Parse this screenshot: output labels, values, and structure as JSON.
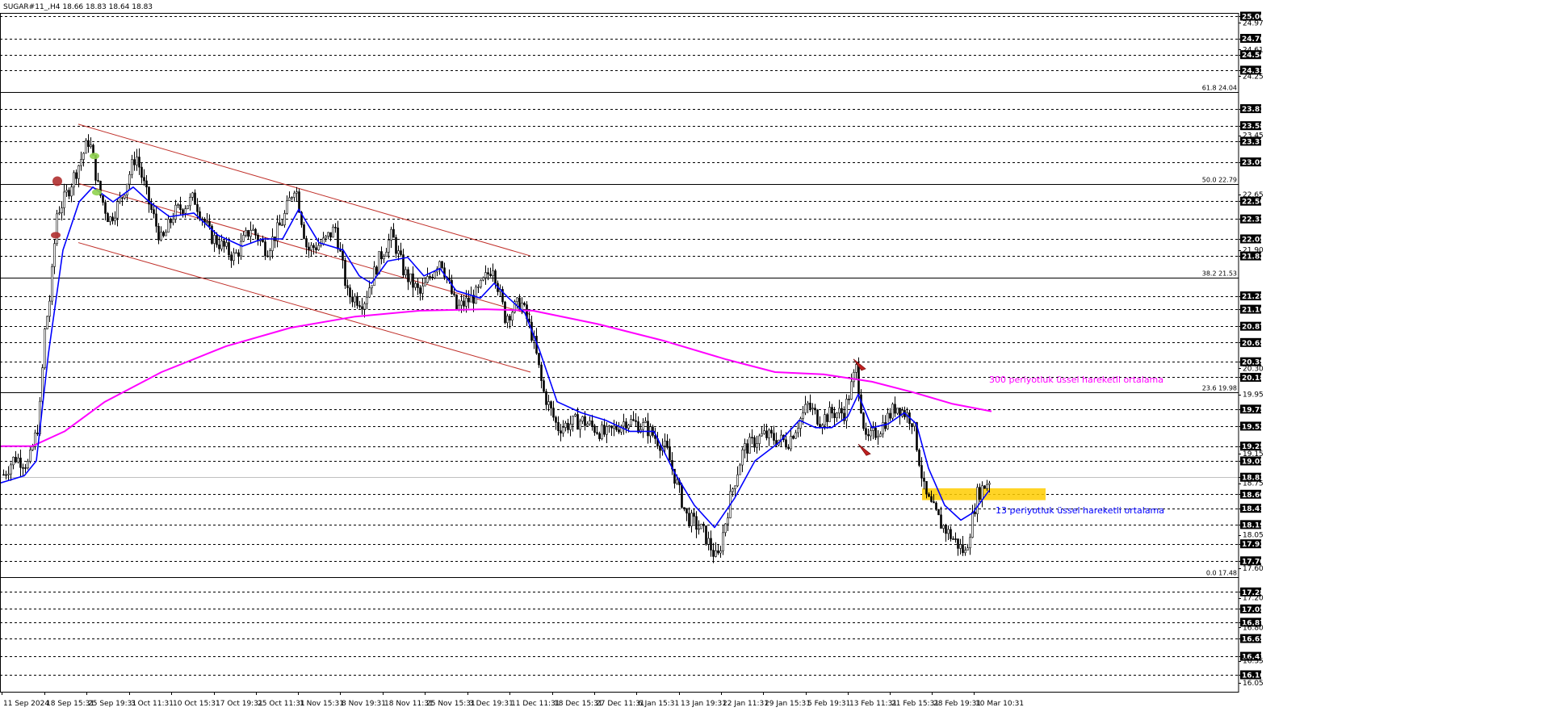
{
  "symbol_info": "SUGAR#11_,H4  18.66 18.83 18.64 18.83",
  "chart_data": {
    "type": "candlestick",
    "title": "",
    "ylim": [
      16.05,
      25.12
    ],
    "price_labels": [
      {
        "text": "25.06",
        "v": 25.06,
        "hl": true
      },
      {
        "text": "24.97",
        "v": 24.97,
        "hl": false
      },
      {
        "text": "24.76",
        "v": 24.76,
        "hl": true
      },
      {
        "text": "24.61",
        "v": 24.61,
        "hl": false
      },
      {
        "text": "24.54",
        "v": 24.54,
        "hl": true
      },
      {
        "text": "24.33",
        "v": 24.33,
        "hl": true
      },
      {
        "text": "24.25",
        "v": 24.25,
        "hl": false
      },
      {
        "text": "23.81",
        "v": 23.81,
        "hl": true
      },
      {
        "text": "23.58",
        "v": 23.58,
        "hl": true
      },
      {
        "text": "23.45",
        "v": 23.45,
        "hl": false
      },
      {
        "text": "23.37",
        "v": 23.37,
        "hl": true
      },
      {
        "text": "23.09",
        "v": 23.09,
        "hl": true
      },
      {
        "text": "22.65",
        "v": 22.65,
        "hl": false
      },
      {
        "text": "22.56",
        "v": 22.56,
        "hl": true
      },
      {
        "text": "22.32",
        "v": 22.32,
        "hl": true
      },
      {
        "text": "22.05",
        "v": 22.05,
        "hl": true
      },
      {
        "text": "21.90",
        "v": 21.9,
        "hl": false
      },
      {
        "text": "21.82",
        "v": 21.82,
        "hl": true
      },
      {
        "text": "21.28",
        "v": 21.28,
        "hl": true
      },
      {
        "text": "21.10",
        "v": 21.1,
        "hl": true
      },
      {
        "text": "20.87",
        "v": 20.87,
        "hl": true
      },
      {
        "text": "20.65",
        "v": 20.65,
        "hl": true
      },
      {
        "text": "20.39",
        "v": 20.39,
        "hl": true
      },
      {
        "text": "20.30",
        "v": 20.3,
        "hl": false
      },
      {
        "text": "20.18",
        "v": 20.18,
        "hl": true
      },
      {
        "text": "19.95",
        "v": 19.95,
        "hl": false
      },
      {
        "text": "19.75",
        "v": 19.75,
        "hl": true
      },
      {
        "text": "19.52",
        "v": 19.52,
        "hl": true
      },
      {
        "text": "19.25",
        "v": 19.25,
        "hl": true
      },
      {
        "text": "19.15",
        "v": 19.15,
        "hl": false
      },
      {
        "text": "19.05",
        "v": 19.05,
        "hl": true
      },
      {
        "text": "18.83",
        "v": 18.83,
        "hl": true
      },
      {
        "text": "18.75",
        "v": 18.75,
        "hl": false
      },
      {
        "text": "18.60",
        "v": 18.6,
        "hl": true
      },
      {
        "text": "18.41",
        "v": 18.41,
        "hl": true
      },
      {
        "text": "18.19",
        "v": 18.19,
        "hl": true
      },
      {
        "text": "18.05",
        "v": 18.05,
        "hl": false
      },
      {
        "text": "17.93",
        "v": 17.93,
        "hl": true
      },
      {
        "text": "17.70",
        "v": 17.7,
        "hl": true
      },
      {
        "text": "17.60",
        "v": 17.6,
        "hl": false
      },
      {
        "text": "17.28",
        "v": 17.28,
        "hl": true
      },
      {
        "text": "17.20",
        "v": 17.2,
        "hl": false
      },
      {
        "text": "17.05",
        "v": 17.05,
        "hl": true
      },
      {
        "text": "16.87",
        "v": 16.87,
        "hl": true
      },
      {
        "text": "16.80",
        "v": 16.8,
        "hl": false
      },
      {
        "text": "16.65",
        "v": 16.65,
        "hl": true
      },
      {
        "text": "16.41",
        "v": 16.41,
        "hl": true
      },
      {
        "text": "16.35",
        "v": 16.35,
        "hl": false
      },
      {
        "text": "16.16",
        "v": 16.16,
        "hl": true
      },
      {
        "text": "16.05",
        "v": 16.05,
        "hl": false
      }
    ],
    "dashed_levels": [
      25.06,
      24.76,
      24.54,
      24.33,
      23.81,
      23.58,
      23.37,
      23.09,
      22.56,
      22.32,
      22.05,
      21.82,
      21.28,
      21.1,
      20.87,
      20.65,
      20.39,
      20.18,
      19.75,
      19.52,
      19.25,
      19.05,
      18.6,
      18.41,
      18.19,
      17.93,
      17.7,
      17.28,
      17.05,
      16.87,
      16.65,
      16.41,
      16.16
    ],
    "fib_levels": [
      {
        "label": "61.8 24.04",
        "v": 24.04
      },
      {
        "label": "50.0 22.79",
        "v": 22.79
      },
      {
        "label": "38.2 21.53",
        "v": 21.53
      },
      {
        "label": "23.6 19.98",
        "v": 19.98
      },
      {
        "label": "0.0 17.48",
        "v": 17.48
      }
    ],
    "current_price": 18.83,
    "time_labels": [
      "11 Sep 2024",
      "18 Sep 15:31",
      "25 Sep 19:31",
      "3 Oct 11:31",
      "10 Oct 15:31",
      "17 Oct 19:31",
      "25 Oct 11:31",
      "1 Nov 15:31",
      "8 Nov 19:31",
      "18 Nov 11:31",
      "25 Nov 15:31",
      "3 Dec 19:31",
      "11 Dec 11:31",
      "18 Dec 15:31",
      "27 Dec 11:31",
      "6 Jan 15:31",
      "13 Jan 19:31",
      "22 Jan 11:31",
      "29 Jan 15:31",
      "5 Feb 19:31",
      "13 Feb 11:31",
      "21 Feb 15:31",
      "28 Feb 19:31",
      "10 Mar 10:31"
    ],
    "price_path": [
      [
        0,
        18.8
      ],
      [
        18,
        19.1
      ],
      [
        35,
        19.0
      ],
      [
        48,
        19.6
      ],
      [
        55,
        20.8
      ],
      [
        62,
        21.3
      ],
      [
        70,
        22.4
      ],
      [
        80,
        22.6
      ],
      [
        95,
        23.0
      ],
      [
        110,
        23.4
      ],
      [
        122,
        22.7
      ],
      [
        135,
        22.3
      ],
      [
        150,
        22.6
      ],
      [
        168,
        23.2
      ],
      [
        182,
        22.6
      ],
      [
        200,
        22.0
      ],
      [
        215,
        22.4
      ],
      [
        240,
        22.6
      ],
      [
        260,
        22.1
      ],
      [
        290,
        21.8
      ],
      [
        310,
        22.2
      ],
      [
        330,
        21.9
      ],
      [
        350,
        22.3
      ],
      [
        365,
        22.8
      ],
      [
        380,
        21.9
      ],
      [
        400,
        22.0
      ],
      [
        415,
        22.2
      ],
      [
        430,
        21.3
      ],
      [
        450,
        21.2
      ],
      [
        470,
        21.8
      ],
      [
        485,
        22.1
      ],
      [
        500,
        21.6
      ],
      [
        520,
        21.3
      ],
      [
        545,
        21.8
      ],
      [
        565,
        21.1
      ],
      [
        590,
        21.3
      ],
      [
        610,
        21.7
      ],
      [
        625,
        21.0
      ],
      [
        645,
        21.2
      ],
      [
        660,
        20.7
      ],
      [
        672,
        20.0
      ],
      [
        690,
        19.5
      ],
      [
        720,
        19.6
      ],
      [
        750,
        19.4
      ],
      [
        775,
        19.6
      ],
      [
        800,
        19.5
      ],
      [
        825,
        19.2
      ],
      [
        850,
        18.3
      ],
      [
        870,
        18.1
      ],
      [
        888,
        17.7
      ],
      [
        905,
        18.6
      ],
      [
        920,
        19.2
      ],
      [
        945,
        19.4
      ],
      [
        975,
        19.3
      ],
      [
        1000,
        19.8
      ],
      [
        1015,
        19.6
      ],
      [
        1030,
        19.7
      ],
      [
        1045,
        19.7
      ],
      [
        1060,
        20.3
      ],
      [
        1072,
        19.3
      ],
      [
        1090,
        19.5
      ],
      [
        1110,
        19.8
      ],
      [
        1130,
        19.6
      ],
      [
        1145,
        18.6
      ],
      [
        1165,
        18.2
      ],
      [
        1180,
        18.0
      ],
      [
        1195,
        17.8
      ],
      [
        1210,
        18.6
      ],
      [
        1225,
        18.8
      ]
    ],
    "series": [
      {
        "name": "300 periyotluk üssel hareketli ortalama",
        "color": "#ff00ff",
        "points": [
          [
            0,
            19.25
          ],
          [
            40,
            19.25
          ],
          [
            80,
            19.45
          ],
          [
            130,
            19.85
          ],
          [
            200,
            20.25
          ],
          [
            280,
            20.6
          ],
          [
            360,
            20.85
          ],
          [
            440,
            21.0
          ],
          [
            520,
            21.08
          ],
          [
            600,
            21.1
          ],
          [
            660,
            21.08
          ],
          [
            740,
            20.9
          ],
          [
            820,
            20.68
          ],
          [
            900,
            20.42
          ],
          [
            960,
            20.25
          ],
          [
            1020,
            20.22
          ],
          [
            1080,
            20.12
          ],
          [
            1130,
            19.98
          ],
          [
            1180,
            19.82
          ],
          [
            1228,
            19.72
          ]
        ]
      },
      {
        "name": "13 periyotluk üssel hareketli ortalama",
        "color": "#0000ff",
        "points": [
          [
            0,
            18.75
          ],
          [
            30,
            18.85
          ],
          [
            45,
            19.05
          ],
          [
            60,
            20.5
          ],
          [
            78,
            21.9
          ],
          [
            98,
            22.55
          ],
          [
            115,
            22.75
          ],
          [
            140,
            22.55
          ],
          [
            165,
            22.75
          ],
          [
            185,
            22.55
          ],
          [
            210,
            22.35
          ],
          [
            240,
            22.4
          ],
          [
            270,
            22.1
          ],
          [
            300,
            21.95
          ],
          [
            325,
            22.05
          ],
          [
            350,
            22.05
          ],
          [
            370,
            22.45
          ],
          [
            395,
            22.0
          ],
          [
            425,
            21.9
          ],
          [
            445,
            21.55
          ],
          [
            460,
            21.45
          ],
          [
            480,
            21.75
          ],
          [
            505,
            21.8
          ],
          [
            525,
            21.55
          ],
          [
            545,
            21.65
          ],
          [
            565,
            21.35
          ],
          [
            595,
            21.25
          ],
          [
            612,
            21.45
          ],
          [
            630,
            21.25
          ],
          [
            650,
            21.05
          ],
          [
            668,
            20.55
          ],
          [
            690,
            19.85
          ],
          [
            720,
            19.7
          ],
          [
            750,
            19.6
          ],
          [
            780,
            19.45
          ],
          [
            810,
            19.45
          ],
          [
            835,
            18.9
          ],
          [
            860,
            18.45
          ],
          [
            885,
            18.15
          ],
          [
            910,
            18.55
          ],
          [
            935,
            19.05
          ],
          [
            965,
            19.3
          ],
          [
            990,
            19.6
          ],
          [
            1010,
            19.5
          ],
          [
            1030,
            19.5
          ],
          [
            1050,
            19.65
          ],
          [
            1063,
            19.95
          ],
          [
            1080,
            19.5
          ],
          [
            1100,
            19.55
          ],
          [
            1120,
            19.7
          ],
          [
            1135,
            19.55
          ],
          [
            1150,
            18.95
          ],
          [
            1170,
            18.45
          ],
          [
            1190,
            18.25
          ],
          [
            1205,
            18.35
          ],
          [
            1225,
            18.65
          ]
        ]
      }
    ],
    "channel": {
      "color": "#c0302a",
      "upper": [
        [
          97,
          23.6
        ],
        [
          657,
          21.82
        ]
      ],
      "mid": [
        [
          97,
          22.8
        ],
        [
          657,
          21.03
        ]
      ],
      "lower": [
        [
          97,
          22.0
        ],
        [
          657,
          20.25
        ]
      ]
    },
    "highlight_zone": {
      "x1": 1142,
      "x2": 1295,
      "y1": 18.52,
      "y2": 18.68,
      "color": "#ffcc00"
    },
    "annotations": [
      {
        "text": "300 periyotluk üssel hareketli ortalama",
        "color": "#ff00ff"
      },
      {
        "text": "13 periyotluk üssel hareketli ortalama",
        "color": "#0000ff"
      }
    ],
    "markers": {
      "green": [
        [
          117,
          23.17
        ],
        [
          120,
          22.68
        ]
      ],
      "red_dots": [
        [
          71,
          22.83
        ],
        [
          69,
          22.1
        ]
      ],
      "red_arrows": [
        [
          1064,
          20.35
        ],
        [
          1070,
          19.2
        ]
      ]
    },
    "legend": "none",
    "grid": false
  }
}
